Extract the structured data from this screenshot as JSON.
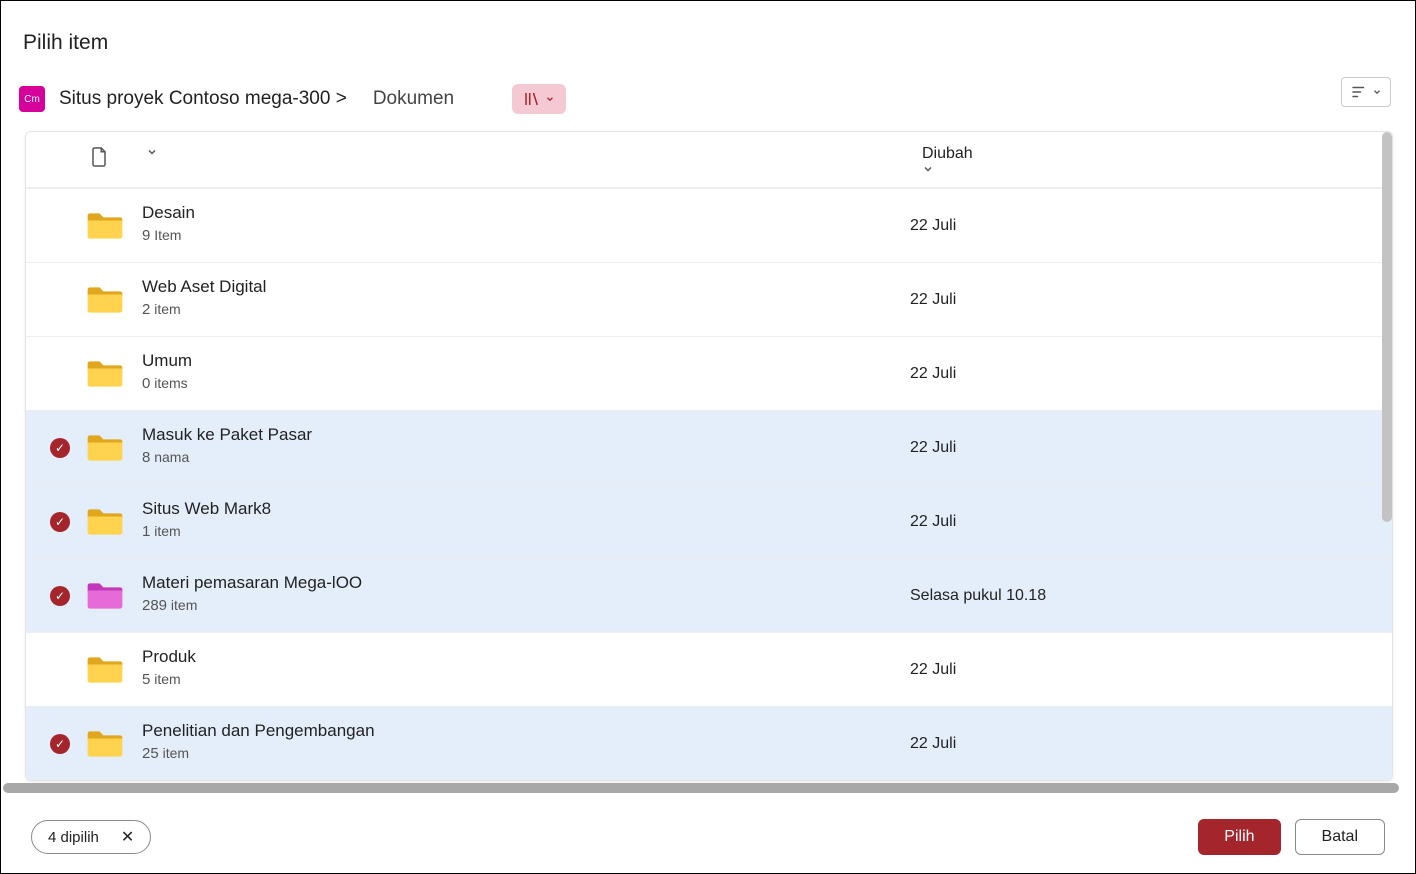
{
  "dialog": {
    "title": "Pilih item"
  },
  "breadcrumb": {
    "site_label": "Situs proyek Contoso mega-300 >",
    "library_label": "Dokumen",
    "site_badge": "Cm"
  },
  "columns": {
    "modified": "Diubah"
  },
  "rows": [
    {
      "name": "Desain",
      "count": "9",
      "count_label": "Item",
      "modified": "22 Juli",
      "selected": false,
      "color": "yellow"
    },
    {
      "name": "Web Aset Digital",
      "count": "2",
      "count_label": "item",
      "modified": "22 Juli",
      "selected": false,
      "color": "yellow"
    },
    {
      "name": "Umum",
      "count": "0",
      "count_label": "items",
      "modified": "22 Juli",
      "selected": false,
      "color": "yellow"
    },
    {
      "name": "Masuk ke Paket Pasar",
      "count": "8",
      "count_label": "nama",
      "modified": "22 Juli",
      "selected": true,
      "color": "yellow"
    },
    {
      "name": "Situs Web Mark8",
      "count": "1",
      "count_label": "item",
      "modified": "22 Juli",
      "selected": true,
      "color": "yellow"
    },
    {
      "name": "Materi pemasaran Mega-lOO",
      "count": "289",
      "count_label": "item",
      "modified": "Selasa pukul 10.18",
      "selected": true,
      "color": "pink"
    },
    {
      "name": "Produk",
      "count": "5",
      "count_label": "item",
      "modified": "22 Juli",
      "selected": false,
      "color": "yellow"
    },
    {
      "name": "Penelitian dan Pengembangan",
      "count": "25",
      "count_label": "item",
      "modified": "22 Juli",
      "selected": true,
      "color": "yellow"
    }
  ],
  "footer": {
    "selection_label": "4 dipilih",
    "primary": "Pilih",
    "secondary": "Batal"
  }
}
